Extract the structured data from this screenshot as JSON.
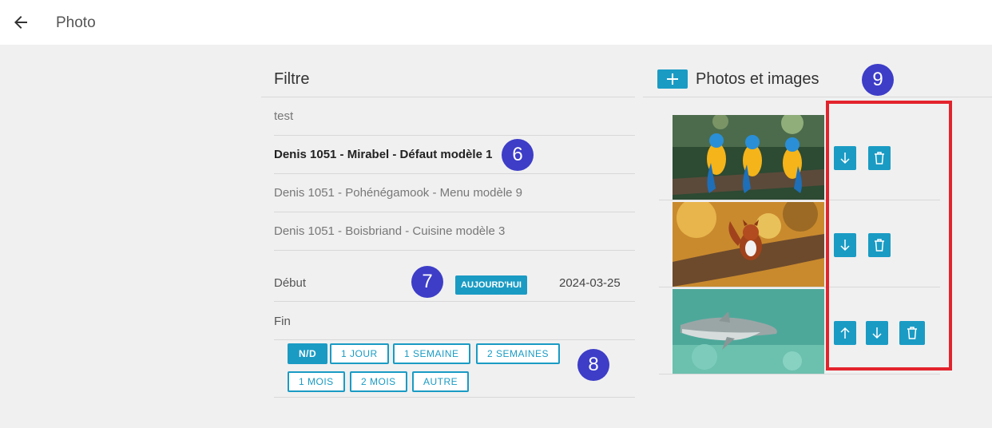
{
  "header": {
    "title": "Photo",
    "back_icon": "arrow-left-icon"
  },
  "filter": {
    "heading": "Filtre",
    "items": [
      {
        "label": "test",
        "active": false
      },
      {
        "label": "Denis 1051 - Mirabel - Défaut modèle 1",
        "active": true
      },
      {
        "label": "Denis 1051 - Pohénégamook - Menu modèle 9",
        "active": false
      },
      {
        "label": "Denis 1051 - Boisbriand - Cuisine modèle 3",
        "active": false
      }
    ],
    "start": {
      "label": "Début",
      "today_label": "AUJOURD'HUI",
      "value": "2024-03-25"
    },
    "end": {
      "label": "Fin"
    },
    "durations": [
      {
        "label": "N/D",
        "selected": true
      },
      {
        "label": "1 JOUR",
        "selected": false
      },
      {
        "label": "1 SEMAINE",
        "selected": false
      },
      {
        "label": "2 SEMAINES",
        "selected": false
      },
      {
        "label": "1 MOIS",
        "selected": false
      },
      {
        "label": "2 MOIS",
        "selected": false
      },
      {
        "label": "AUTRE",
        "selected": false
      }
    ]
  },
  "photos": {
    "heading": "Photos et images",
    "add_icon": "plus-icon",
    "items": [
      {
        "subject": "parrots",
        "actions": [
          "arrow-down-icon",
          "trash-icon"
        ]
      },
      {
        "subject": "squirrel",
        "actions": [
          "arrow-down-icon",
          "trash-icon"
        ]
      },
      {
        "subject": "dolphin",
        "actions": [
          "arrow-up-icon",
          "arrow-down-icon",
          "trash-icon"
        ]
      }
    ]
  },
  "callouts": [
    "6",
    "7",
    "8",
    "9"
  ],
  "colors": {
    "accent": "#1a9bc4",
    "callout": "#3d3dc8",
    "highlight": "#e3232c"
  }
}
